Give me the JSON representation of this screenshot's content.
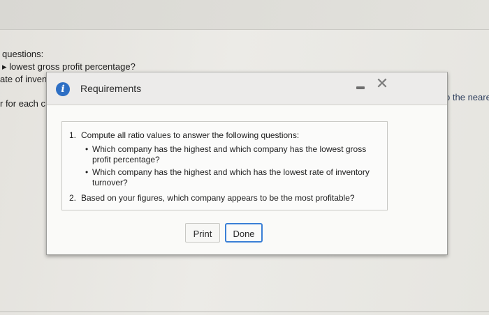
{
  "background": {
    "lines": [
      "questions:",
      "lowest gross profit percentage?",
      "ate of invent",
      "r for each c"
    ],
    "right_text": "ercentage to the neares"
  },
  "modal": {
    "title": "Requirements",
    "icon": "info-icon",
    "requirements": [
      {
        "number": "1.",
        "text": "Compute all ratio values to answer the following questions:",
        "bullets": [
          [
            "Which company has the highest and which company has the lowest gross",
            "profit percentage?"
          ],
          [
            "Which company has the highest and which has the lowest rate of inventory",
            "turnover?"
          ]
        ]
      },
      {
        "number": "2.",
        "text": "Based on your figures, which company appears to be the most profitable?"
      }
    ],
    "buttons": {
      "print": "Print",
      "done": "Done"
    }
  },
  "colors": {
    "accent": "#3a7fd6",
    "info_icon": "#2e6fc4",
    "link": "#1b3f8f"
  }
}
